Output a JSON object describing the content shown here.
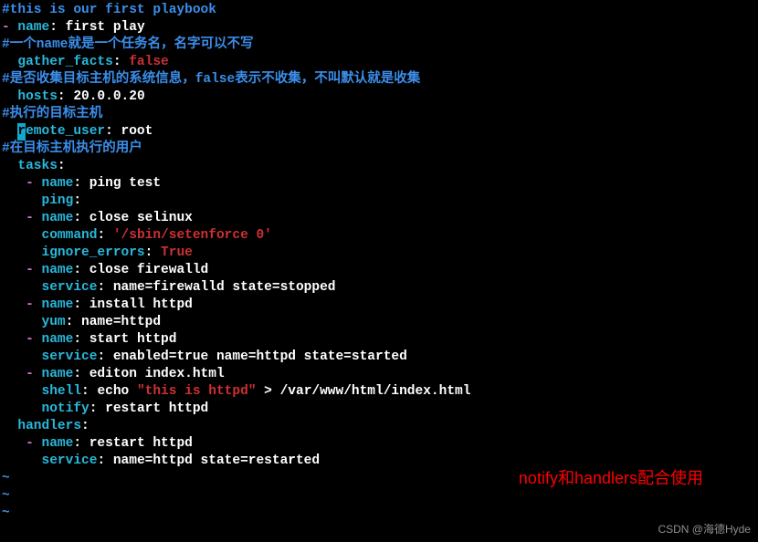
{
  "lines": {
    "c1": "#this is our first playbook",
    "l2_dash": "- ",
    "l2_key": "name",
    "l2_colon": ": ",
    "l2_val": "first play",
    "c2": "#一个name就是一个任务名，名字可以不写",
    "l4_indent": "  ",
    "l4_key": "gather_facts",
    "l4_colon": ": ",
    "l4_val": "false",
    "c3": "#是否收集目标主机的系统信息，false表示不收集，不叫默认就是收集",
    "l6_indent": "  ",
    "l6_key": "hosts",
    "l6_colon": ": ",
    "l6_val": "20.0.0.20",
    "c4": "#执行的目标主机",
    "l8_indent": "  ",
    "l8_cursor": "r",
    "l8_key_rest": "emote_user",
    "l8_colon": ": ",
    "l8_val": "root",
    "c5": "#在目标主机执行的用户",
    "l10_indent": "  ",
    "l10_key": "tasks",
    "l10_colon": ":",
    "t1_indent": "   ",
    "t1_dash": "- ",
    "t1_key": "name",
    "t1_colon": ": ",
    "t1_val": "ping test",
    "t1b_indent": "     ",
    "t1b_key": "ping",
    "t1b_colon": ":",
    "t2_indent": "   ",
    "t2_dash": "- ",
    "t2_key": "name",
    "t2_colon": ": ",
    "t2_val": "close selinux",
    "t2b_indent": "     ",
    "t2b_key": "command",
    "t2b_colon": ": ",
    "t2b_val": "'/sbin/setenforce 0'",
    "t2c_indent": "     ",
    "t2c_key": "ignore_errors",
    "t2c_colon": ": ",
    "t2c_val": "True",
    "t3_indent": "   ",
    "t3_dash": "- ",
    "t3_key": "name",
    "t3_colon": ": ",
    "t3_val": "close firewalld",
    "t3b_indent": "     ",
    "t3b_key": "service",
    "t3b_colon": ": ",
    "t3b_val": "name=firewalld state=stopped",
    "t4_indent": "   ",
    "t4_dash": "- ",
    "t4_key": "name",
    "t4_colon": ": ",
    "t4_val": "install httpd",
    "t4b_indent": "     ",
    "t4b_key": "yum",
    "t4b_colon": ": ",
    "t4b_val": "name=httpd",
    "t5_indent": "   ",
    "t5_dash": "- ",
    "t5_key": "name",
    "t5_colon": ": ",
    "t5_val": "start httpd",
    "t5b_indent": "     ",
    "t5b_key": "service",
    "t5b_colon": ": ",
    "t5b_val": "enabled=true name=httpd state=started",
    "t6_indent": "   ",
    "t6_dash": "- ",
    "t6_key": "name",
    "t6_colon": ": ",
    "t6_val": "editon index.html",
    "t6b_indent": "     ",
    "t6b_key": "shell",
    "t6b_colon": ": ",
    "t6b_val1": "echo ",
    "t6b_val2": "\"this is httpd\"",
    "t6b_val3": " > /var/www/html/index.html",
    "t6c_indent": "     ",
    "t6c_key": "notify",
    "t6c_colon": ": ",
    "t6c_val": "restart httpd",
    "h_indent": "  ",
    "h_key": "handlers",
    "h_colon": ":",
    "h1_indent": "   ",
    "h1_dash": "- ",
    "h1_key": "name",
    "h1_colon": ": ",
    "h1_val": "restart httpd",
    "h1b_indent": "     ",
    "h1b_key": "service",
    "h1b_colon": ": ",
    "h1b_val": "name=httpd state=restarted",
    "tilde": "~"
  },
  "annotation": "notify和handlers配合使用",
  "watermark": "CSDN @海德Hyde"
}
